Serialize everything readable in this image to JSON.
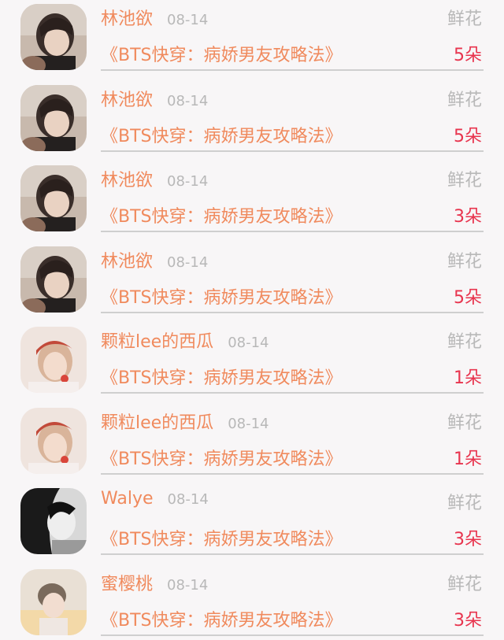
{
  "gift_list": [
    {
      "user": "林池欲",
      "date": "08-14",
      "gift": "鲜花",
      "book": "《BTS快穿：病娇男友攻略法》",
      "amount": "5朵",
      "avatar": "avatar-1"
    },
    {
      "user": "林池欲",
      "date": "08-14",
      "gift": "鲜花",
      "book": "《BTS快穿：病娇男友攻略法》",
      "amount": "5朵",
      "avatar": "avatar-1"
    },
    {
      "user": "林池欲",
      "date": "08-14",
      "gift": "鲜花",
      "book": "《BTS快穿：病娇男友攻略法》",
      "amount": "3朵",
      "avatar": "avatar-1"
    },
    {
      "user": "林池欲",
      "date": "08-14",
      "gift": "鲜花",
      "book": "《BTS快穿：病娇男友攻略法》",
      "amount": "5朵",
      "avatar": "avatar-1"
    },
    {
      "user": "颗粒lee的西瓜",
      "date": "08-14",
      "gift": "鲜花",
      "book": "《BTS快穿：病娇男友攻略法》",
      "amount": "1朵",
      "avatar": "avatar-2"
    },
    {
      "user": "颗粒lee的西瓜",
      "date": "08-14",
      "gift": "鲜花",
      "book": "《BTS快穿：病娇男友攻略法》",
      "amount": "1朵",
      "avatar": "avatar-2"
    },
    {
      "user": "Walye",
      "date": "08-14",
      "gift": "鲜花",
      "book": "《BTS快穿：病娇男友攻略法》",
      "amount": "3朵",
      "avatar": "avatar-3"
    },
    {
      "user": "蜜樱桃",
      "date": "08-14",
      "gift": "鲜花",
      "book": "《BTS快穿：病娇男友攻略法》",
      "amount": "3朵",
      "avatar": "avatar-4"
    }
  ],
  "colors": {
    "name": "#f08a5d",
    "book": "#f08a5d",
    "amount": "#e8344e",
    "muted": "#b8b8b8"
  }
}
